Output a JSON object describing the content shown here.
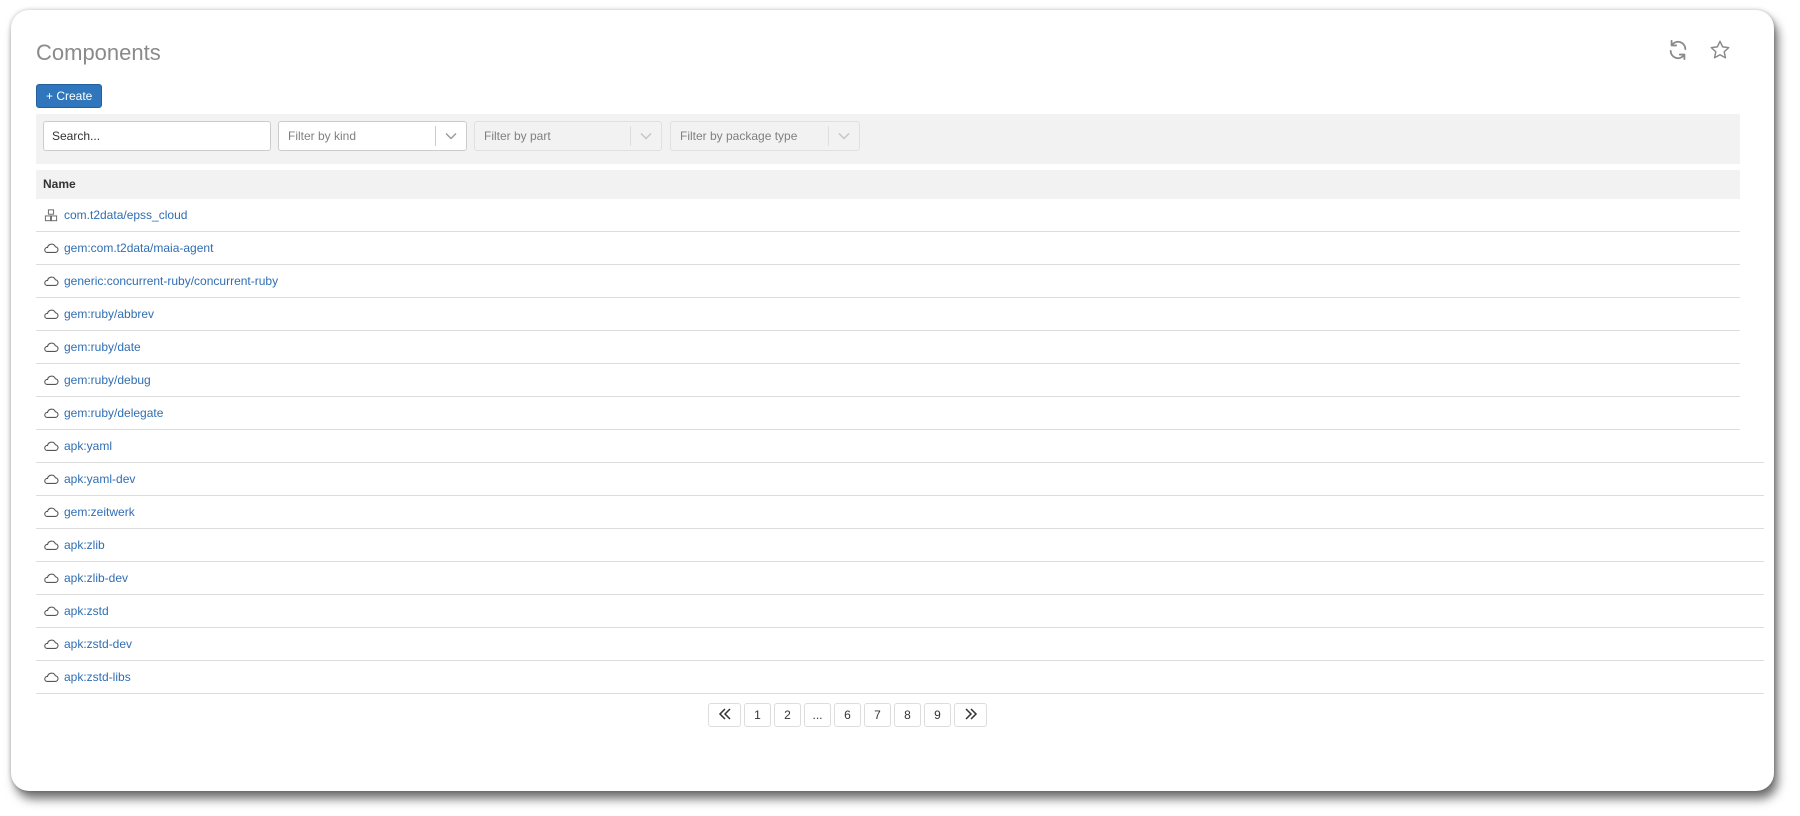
{
  "page": {
    "title": "Components",
    "actions": [
      {
        "icon": "refresh-icon"
      },
      {
        "icon": "star-icon"
      }
    ]
  },
  "toolbar": {
    "create_label": "+ Create"
  },
  "filters": {
    "search_placeholder": "Search...",
    "kind_placeholder": "Filter by kind",
    "part_placeholder": "Filter by part",
    "package_type_placeholder": "Filter by package type"
  },
  "table": {
    "columns": [
      "Name"
    ],
    "rows": [
      {
        "name": "com.t2data/epss_cloud",
        "icon": "cubes-icon"
      },
      {
        "name": "gem:com.t2data/maia-agent",
        "icon": "cloud-icon"
      },
      {
        "name": "generic:concurrent-ruby/concurrent-ruby",
        "icon": "cloud-icon"
      },
      {
        "name": "gem:ruby/abbrev",
        "icon": "cloud-icon"
      },
      {
        "name": "gem:ruby/date",
        "icon": "cloud-icon"
      },
      {
        "name": "gem:ruby/debug",
        "icon": "cloud-icon"
      },
      {
        "name": "gem:ruby/delegate",
        "icon": "cloud-icon"
      },
      {
        "name": "apk:yaml",
        "icon": "cloud-icon"
      },
      {
        "name": "apk:yaml-dev",
        "icon": "cloud-icon"
      },
      {
        "name": "gem:zeitwerk",
        "icon": "cloud-icon"
      },
      {
        "name": "apk:zlib",
        "icon": "cloud-icon"
      },
      {
        "name": "apk:zlib-dev",
        "icon": "cloud-icon"
      },
      {
        "name": "apk:zstd",
        "icon": "cloud-icon"
      },
      {
        "name": "apk:zstd-dev",
        "icon": "cloud-icon"
      },
      {
        "name": "apk:zstd-libs",
        "icon": "cloud-icon"
      }
    ]
  },
  "pagination": {
    "first_icon": "double-chevron-left-icon",
    "last_icon": "double-chevron-right-icon",
    "pages": [
      "1",
      "2",
      "...",
      "6",
      "7",
      "8",
      "9"
    ]
  },
  "colors": {
    "accent": "#2f76bd",
    "link": "#2f6eb3",
    "header_bg": "#f2f2f2"
  }
}
